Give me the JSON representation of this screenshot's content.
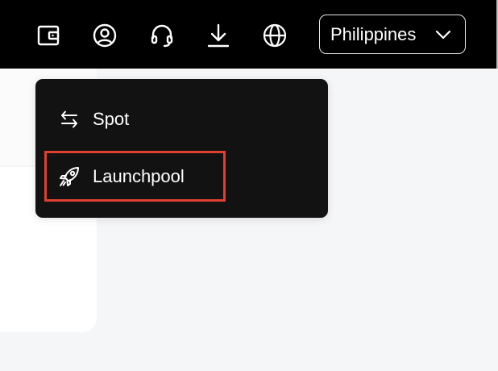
{
  "topbar": {
    "icons": [
      "wallet-icon",
      "user-icon",
      "headset-icon",
      "download-icon",
      "globe-icon"
    ],
    "region_label": "Philippines"
  },
  "dropdown": {
    "items": [
      {
        "label": "Spot",
        "icon": "swap-arrows-icon"
      },
      {
        "label": "Launchpool",
        "icon": "rocket-icon"
      }
    ],
    "highlighted_item": "Launchpool",
    "highlight_color": "#e0402f"
  },
  "colors": {
    "topbar_bg": "#000000",
    "menu_bg": "#121212",
    "page_bg": "#f5f6f8"
  }
}
